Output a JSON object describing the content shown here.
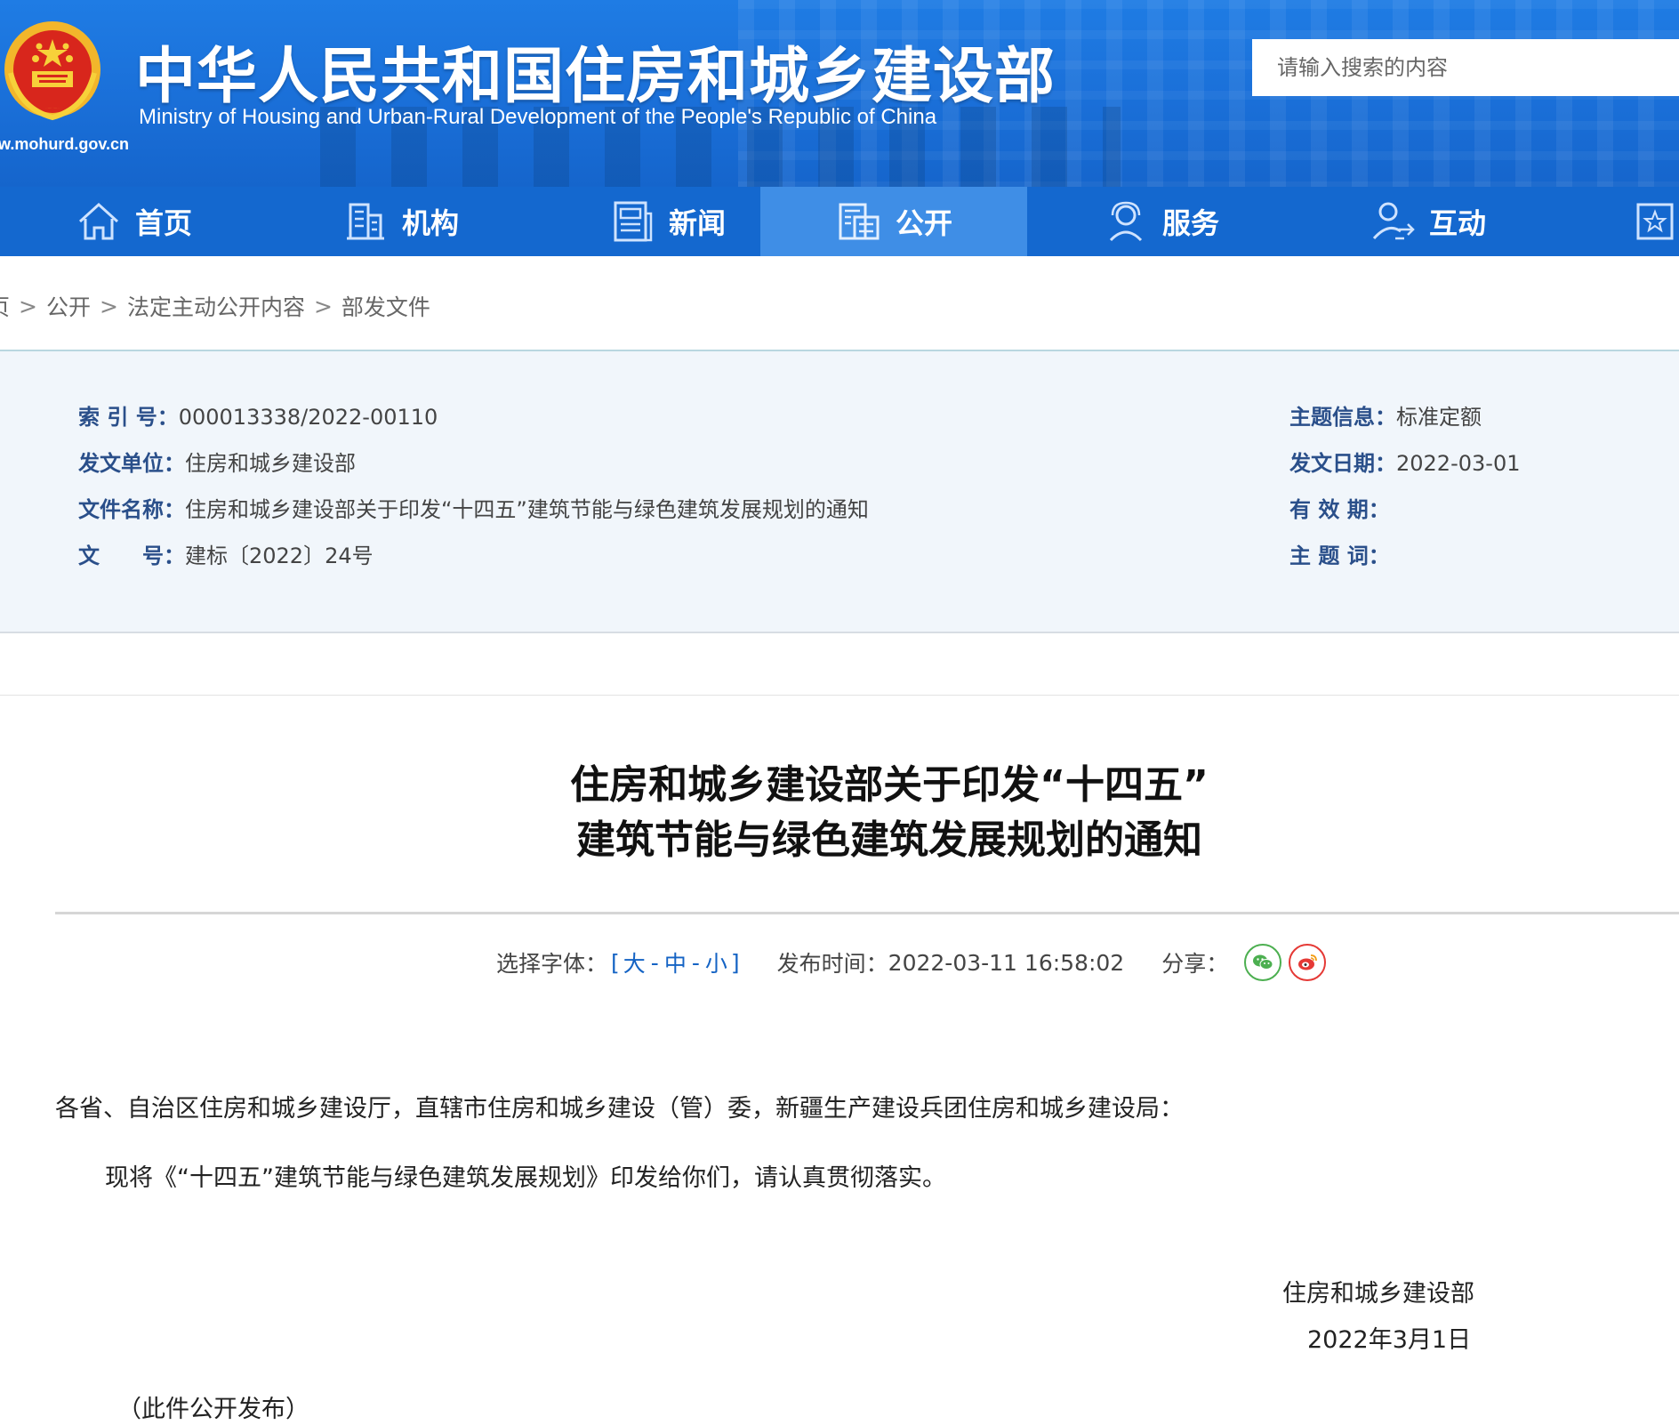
{
  "header": {
    "title": "中华人民共和国住房和城乡建设部",
    "subtitle": "Ministry of Housing and Urban-Rural Development of the People's Republic of China",
    "url": "www.mohurd.gov.cn",
    "search_placeholder": "请输入搜索的内容"
  },
  "nav": {
    "items": [
      {
        "label": "首页",
        "icon": "home-icon"
      },
      {
        "label": "机构",
        "icon": "building-icon"
      },
      {
        "label": "新闻",
        "icon": "news-icon"
      },
      {
        "label": "公开",
        "icon": "disclosure-icon",
        "active": true
      },
      {
        "label": "服务",
        "icon": "service-icon"
      },
      {
        "label": "互动",
        "icon": "interaction-icon"
      },
      {
        "label": "",
        "icon": "favorite-icon"
      }
    ]
  },
  "breadcrumb": {
    "items": [
      "页",
      "公开",
      "法定主动公开内容",
      "部发文件"
    ],
    "separator": ">"
  },
  "meta": {
    "left": [
      {
        "label": "索 引 号：",
        "value": "000013338/2022-00110"
      },
      {
        "label": "发文单位：",
        "value": "住房和城乡建设部"
      },
      {
        "label": "文件名称：",
        "value": "住房和城乡建设部关于印发“十四五”建筑节能与绿色建筑发展规划的通知"
      },
      {
        "label": "文　　号：",
        "value": "建标〔2022〕24号"
      }
    ],
    "right": [
      {
        "label": "主题信息：",
        "value": "标准定额"
      },
      {
        "label": "发文日期：",
        "value": "2022-03-01"
      },
      {
        "label": "有 效 期：",
        "value": ""
      },
      {
        "label": "主 题 词：",
        "value": ""
      }
    ]
  },
  "article": {
    "title_line1": "住房和城乡建设部关于印发“十四五”",
    "title_line2": "建筑节能与绿色建筑发展规划的通知",
    "font_label": "选择字体：",
    "font_open": "[",
    "font_large": "大",
    "font_dash1": "-",
    "font_medium": "中",
    "font_dash2": "-",
    "font_small": "小",
    "font_close": "]",
    "publish_label": "发布时间：",
    "publish_time": "2022-03-11 16:58:02",
    "share_label": "分享：",
    "salutation": "各省、自治区住房和城乡建设厅，直辖市住房和城乡建设（管）委，新疆生产建设兵团住房和城乡建设局：",
    "paragraph1": "现将《“十四五”建筑节能与绿色建筑发展规划》印发给你们，请认真贯彻落实。",
    "signature_org": "住房和城乡建设部",
    "signature_date": "2022年3月1日",
    "note": "（此件公开发布）"
  },
  "colors": {
    "header_blue": "#1a6fd8",
    "nav_blue": "#1468cf",
    "nav_active": "#3f8ee6",
    "meta_label": "#2a4f8a",
    "link_blue": "#1463c4"
  }
}
